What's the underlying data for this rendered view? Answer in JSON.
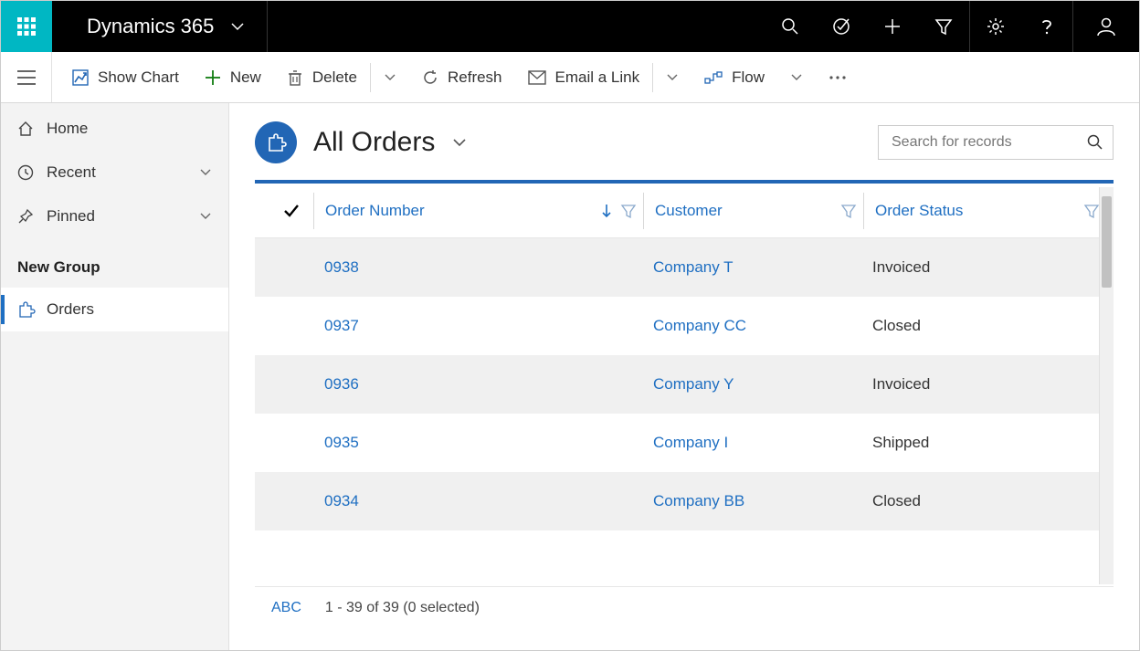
{
  "topbar": {
    "brand": "Dynamics 365"
  },
  "commands": {
    "show_chart": "Show Chart",
    "new": "New",
    "delete": "Delete",
    "refresh": "Refresh",
    "email_link": "Email a Link",
    "flow": "Flow"
  },
  "sidebar": {
    "home": "Home",
    "recent": "Recent",
    "pinned": "Pinned",
    "group_header": "New Group",
    "orders": "Orders"
  },
  "view": {
    "title": "All Orders",
    "search_placeholder": "Search for records"
  },
  "grid": {
    "headers": {
      "order_number": "Order Number",
      "customer": "Customer",
      "order_status": "Order Status"
    },
    "rows": [
      {
        "order_number": "0938",
        "customer": "Company T",
        "status": "Invoiced"
      },
      {
        "order_number": "0937",
        "customer": "Company CC",
        "status": "Closed"
      },
      {
        "order_number": "0936",
        "customer": "Company Y",
        "status": "Invoiced"
      },
      {
        "order_number": "0935",
        "customer": "Company I",
        "status": "Shipped"
      },
      {
        "order_number": "0934",
        "customer": "Company BB",
        "status": "Closed"
      }
    ],
    "footer": {
      "abc": "ABC",
      "count": "1 - 39 of 39 (0 selected)"
    }
  }
}
